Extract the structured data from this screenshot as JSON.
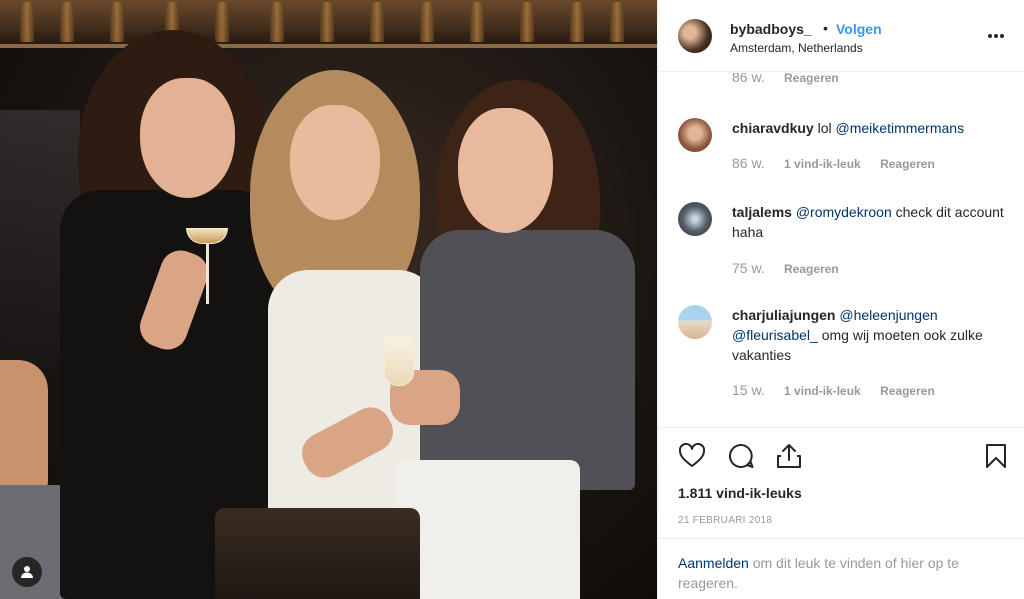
{
  "colors": {
    "link_blue": "#3897f0",
    "mention_blue": "#003569",
    "meta_gray": "#999999",
    "text_dark": "#262626"
  },
  "photo": {
    "user_tag_icon": "person-icon"
  },
  "header": {
    "username": "bybadboys_",
    "separator": "•",
    "follow_label": "Volgen",
    "location": "Amsterdam, Netherlands",
    "more_icon": "more-horizontal-icon"
  },
  "prev_comment": {
    "time": "86 w.",
    "reply": "Reageren"
  },
  "comments": [
    {
      "user": "chiaravdkuy",
      "text": "lol",
      "mentions": [
        "@meiketimmermans"
      ],
      "text_after": "",
      "time": "86 w.",
      "likes": "1 vind-ik-leuk",
      "reply": "Reageren"
    },
    {
      "user": "taljalems",
      "text": "",
      "mentions": [
        "@romydekroon"
      ],
      "text_after": "check dit account haha",
      "time": "75 w.",
      "likes": "",
      "reply": "Reageren"
    },
    {
      "user": "charjuliajungen",
      "text": "",
      "mentions": [
        "@heleenjungen",
        "@fleurisabel_"
      ],
      "text_after": "omg wij moeten ook zulke vakanties",
      "time": "15 w.",
      "likes": "1 vind-ik-leuk",
      "reply": "Reageren"
    }
  ],
  "actions": {
    "like_icon": "heart-icon",
    "comment_icon": "comment-icon",
    "share_icon": "share-icon",
    "save_icon": "bookmark-icon",
    "likes_count": "1.811 vind-ik-leuks",
    "date": "21 FEBRUARI 2018"
  },
  "login": {
    "link_text": "Aanmelden",
    "rest_text": "om dit leuk te vinden of hier op te reageren."
  }
}
